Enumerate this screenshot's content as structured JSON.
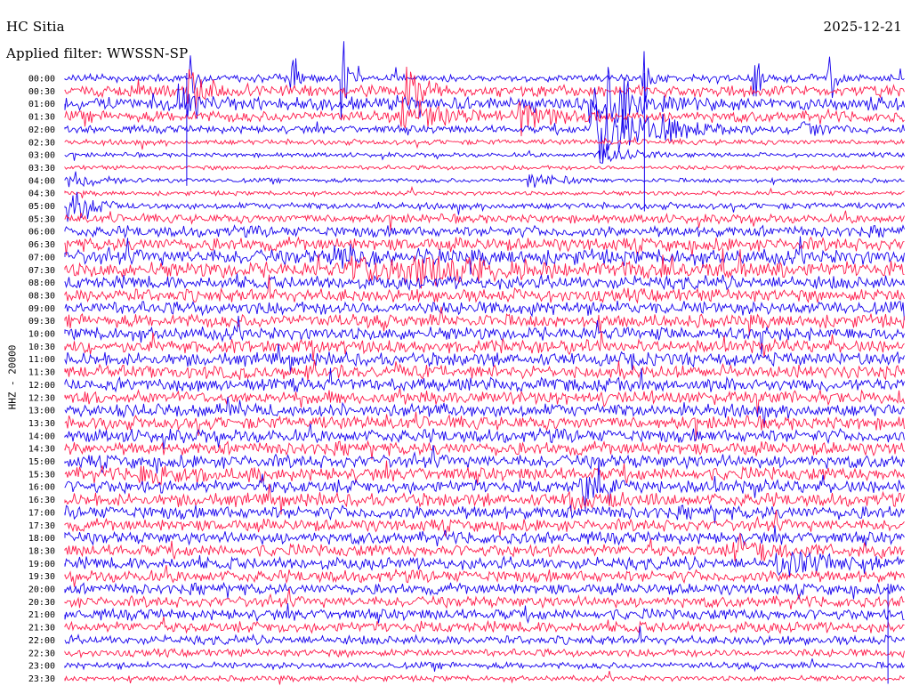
{
  "header": {
    "station": "HC Sitia",
    "date": "2025-12-21",
    "filter": "Applied filter: WWSSN-SP"
  },
  "channel_label": "HHZ - 20000",
  "chart_data": {
    "type": "line",
    "title": "HC Sitia",
    "subtitle": "Applied filter: WWSSN-SP",
    "ylabel": "HHZ - 20000",
    "colors": [
      "#1500ee",
      "#ff1a4a"
    ],
    "row_labels": [
      "00:00",
      "00:30",
      "01:00",
      "01:30",
      "02:00",
      "02:30",
      "03:00",
      "03:30",
      "04:00",
      "04:30",
      "05:00",
      "05:30",
      "06:00",
      "06:30",
      "07:00",
      "07:30",
      "08:00",
      "08:30",
      "09:00",
      "09:30",
      "10:00",
      "10:30",
      "11:00",
      "11:30",
      "12:00",
      "12:30",
      "13:00",
      "13:30",
      "14:00",
      "14:30",
      "15:00",
      "15:30",
      "16:00",
      "16:30",
      "17:00",
      "17:30",
      "18:00",
      "18:30",
      "19:00",
      "19:30",
      "20:00",
      "20:30",
      "21:00",
      "21:30",
      "22:00",
      "22:30",
      "23:00",
      "23:30"
    ],
    "noise_level": [
      3.5,
      5,
      6,
      5,
      3.5,
      2.5,
      2,
      2,
      2,
      2,
      3,
      4,
      5,
      6,
      7,
      7,
      6,
      6,
      6,
      6,
      6,
      6,
      6,
      6,
      6,
      6,
      6,
      6,
      6,
      6,
      6,
      6,
      6,
      6,
      6,
      5.5,
      5.5,
      5.5,
      5.5,
      5.5,
      5,
      5,
      5,
      5,
      4,
      3.5,
      3,
      2.5
    ],
    "events": [
      {
        "row": 0,
        "x": 0.27,
        "amp": 80,
        "width": 0.003
      },
      {
        "row": 0,
        "x": 0.33,
        "amp": 90,
        "width": 0.003
      },
      {
        "row": 0,
        "x": 0.69,
        "amp": 60,
        "width": 0.004
      },
      {
        "row": 0,
        "x": 0.82,
        "amp": 80,
        "width": 0.003
      },
      {
        "row": 0,
        "x": 0.15,
        "amp": 50,
        "width": 0.003
      },
      {
        "row": 0,
        "x": 0.91,
        "amp": 40,
        "width": 0.004
      },
      {
        "row": 1,
        "x": 0.41,
        "amp": 50,
        "width": 0.01
      },
      {
        "row": 1,
        "x": 0.15,
        "amp": 25,
        "width": 0.012
      },
      {
        "row": 2,
        "x": 0.64,
        "amp": 60,
        "width": 0.02
      },
      {
        "row": 2,
        "x": 0.14,
        "amp": 20,
        "width": 0.01
      },
      {
        "row": 3,
        "x": 0.41,
        "amp": 25,
        "width": 0.02
      },
      {
        "row": 3,
        "x": 0.55,
        "amp": 20,
        "width": 0.02
      },
      {
        "row": 4,
        "x": 0.64,
        "amp": 45,
        "width": 0.03
      },
      {
        "row": 4,
        "x": 0.72,
        "amp": 12,
        "width": 0.02
      },
      {
        "row": 4,
        "x": 0.88,
        "amp": 10,
        "width": 0.015
      },
      {
        "row": 6,
        "x": 0.64,
        "amp": 14,
        "width": 0.02
      },
      {
        "row": 8,
        "x": 0.01,
        "amp": 10,
        "width": 0.02
      },
      {
        "row": 8,
        "x": 0.56,
        "amp": 10,
        "width": 0.02
      },
      {
        "row": 10,
        "x": 0.01,
        "amp": 20,
        "width": 0.015
      },
      {
        "row": 14,
        "x": 0.33,
        "amp": 14,
        "width": 0.02
      },
      {
        "row": 15,
        "x": 0.35,
        "amp": 14,
        "width": 0.025
      },
      {
        "row": 15,
        "x": 0.44,
        "amp": 14,
        "width": 0.07
      },
      {
        "row": 31,
        "x": 0.1,
        "amp": 14,
        "width": 0.025
      },
      {
        "row": 32,
        "x": 0.62,
        "amp": 18,
        "width": 0.015
      },
      {
        "row": 33,
        "x": 0.61,
        "amp": 14,
        "width": 0.02
      },
      {
        "row": 38,
        "x": 0.86,
        "amp": 14,
        "width": 0.03
      },
      {
        "row": 37,
        "x": 0.81,
        "amp": 12,
        "width": 0.03
      }
    ],
    "long_spikes": [
      {
        "x": 0.69,
        "from_row": 0,
        "to_row": 10
      },
      {
        "x": 0.145,
        "from_row": 0,
        "to_row": 8
      },
      {
        "x": 0.98,
        "from_row": 40,
        "to_row": 47
      }
    ]
  }
}
